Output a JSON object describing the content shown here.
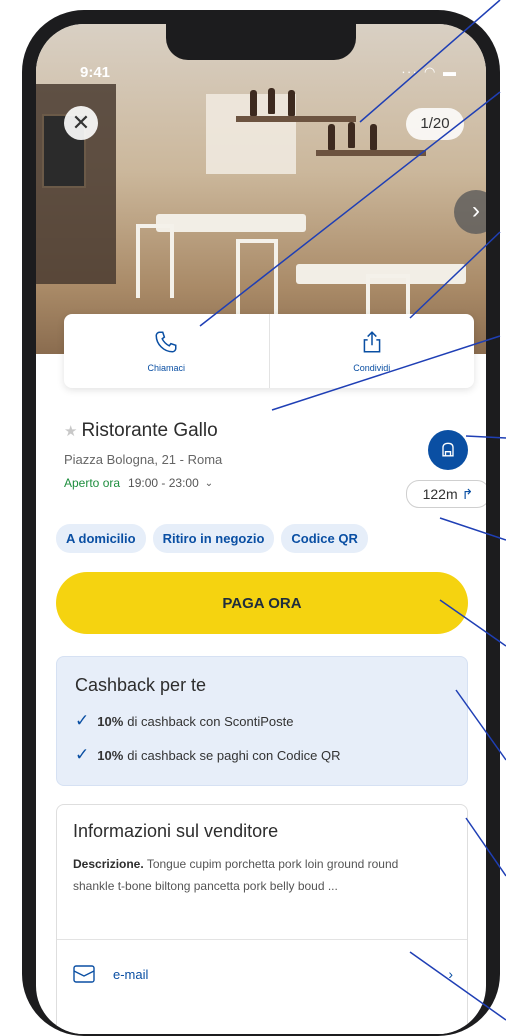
{
  "status": {
    "time": "9:41",
    "icons": "∙∙∙ ◠ ▬"
  },
  "gallery": {
    "counter": "1/20",
    "close_glyph": "✕",
    "next_glyph": "›"
  },
  "actions": {
    "call_label": "Chiamaci",
    "share_label": "Condividi"
  },
  "venue": {
    "star": "★",
    "name": "Ristorante Gallo",
    "address": "Piazza Bologna, 21 - Roma",
    "open_status": "Aperto ora",
    "hours": "19:00 - 23:00",
    "hours_chevron": "⌄",
    "distance": "122m",
    "distance_arrow": "↱"
  },
  "chips": [
    "A domicilio",
    "Ritiro in negozio",
    "Codice QR"
  ],
  "pay_button": "PAGA ORA",
  "cashback": {
    "title": "Cashback per te",
    "items": [
      {
        "check": "✓",
        "percent": "10%",
        "text": "di cashback con ScontiPoste"
      },
      {
        "check": "✓",
        "percent": "10%",
        "text": "di cashback se paghi con Codice QR"
      }
    ]
  },
  "seller": {
    "title": "Informazioni sul venditore",
    "desc_label": "Descrizione.",
    "desc_text": "Tongue cupim porchetta pork loin ground round shankle t-bone biltong pancetta pork belly boud ...",
    "email_label": "e-mail",
    "email_chevron": "›"
  },
  "colors": {
    "brand_blue": "#0a4fa3",
    "pay_yellow": "#f5d310",
    "open_green": "#1e8e3e",
    "cashback_bg": "#e7eef9"
  }
}
